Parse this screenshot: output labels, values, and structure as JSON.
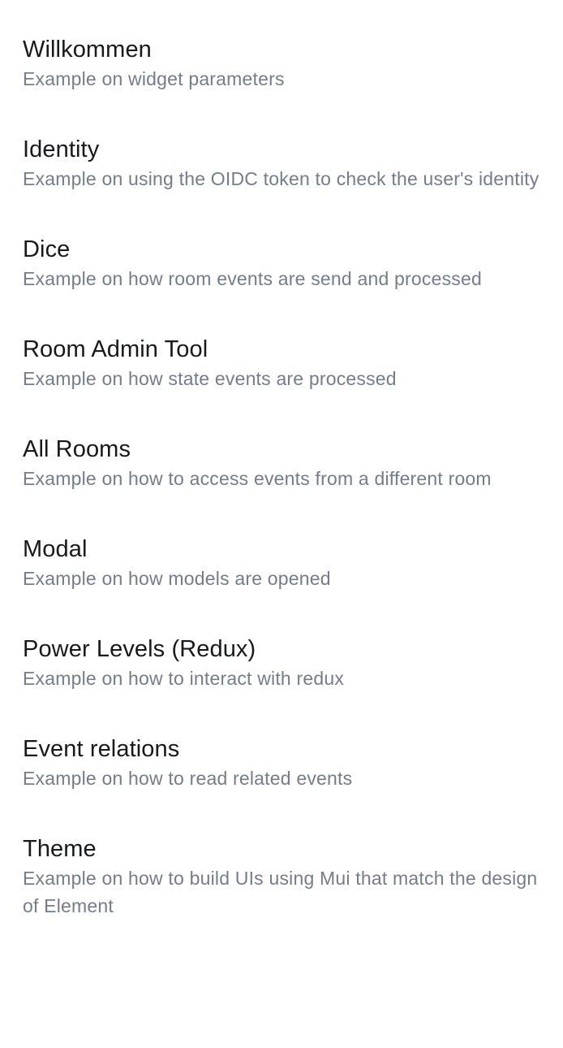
{
  "examples": [
    {
      "title": "Willkommen",
      "description": "Example on widget parameters"
    },
    {
      "title": "Identity",
      "description": "Example on using the OIDC token to check the user's identity"
    },
    {
      "title": "Dice",
      "description": "Example on how room events are send and processed"
    },
    {
      "title": "Room Admin Tool",
      "description": "Example on how state events are processed"
    },
    {
      "title": "All Rooms",
      "description": "Example on how to access events from a different room"
    },
    {
      "title": "Modal",
      "description": "Example on how models are opened"
    },
    {
      "title": "Power Levels (Redux)",
      "description": "Example on how to interact with redux"
    },
    {
      "title": "Event relations",
      "description": "Example on how to read related events"
    },
    {
      "title": "Theme",
      "description": "Example on how to build UIs using Mui that match the design of Element"
    }
  ]
}
